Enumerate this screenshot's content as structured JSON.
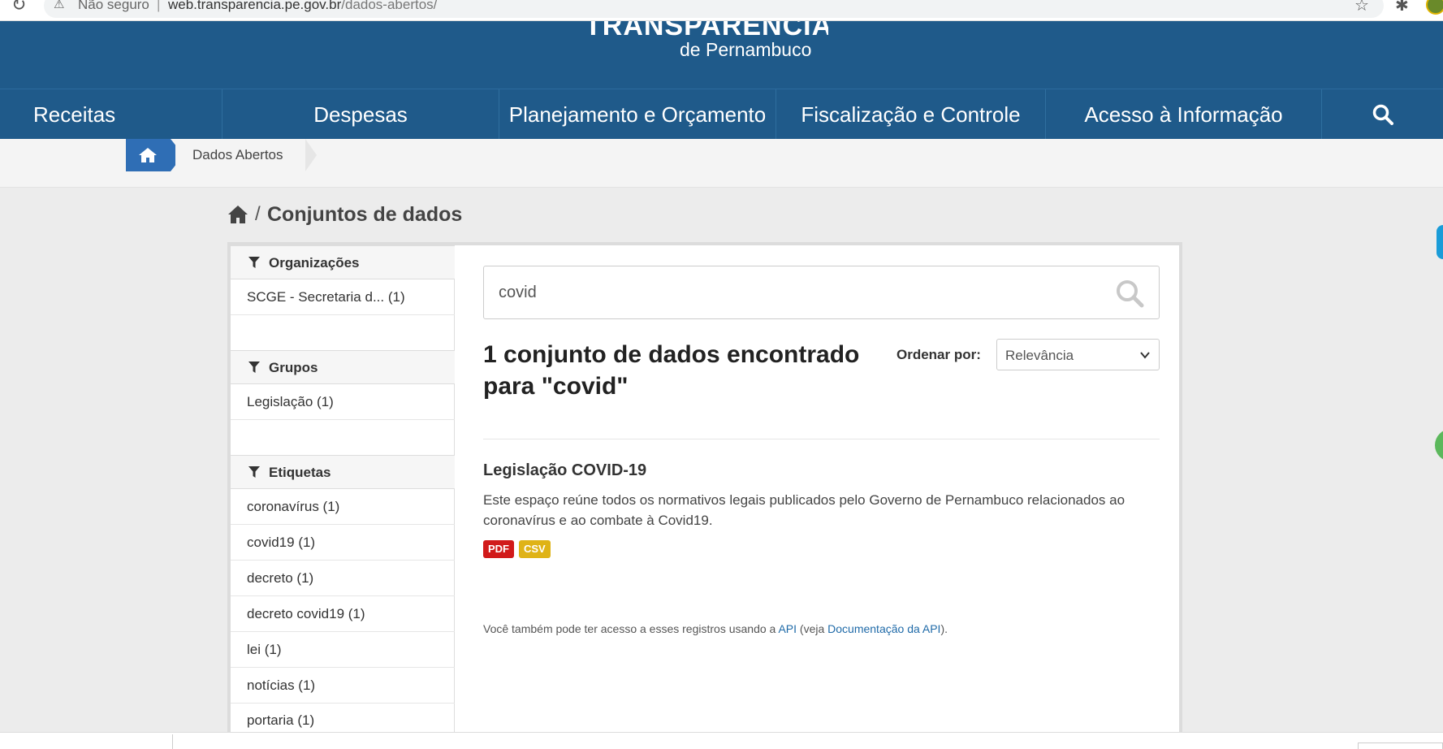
{
  "browser": {
    "security_label": "Não seguro",
    "separator": "|",
    "url_host": "web.transparencia.pe.gov.br",
    "url_path": "/dados-abertos/"
  },
  "header": {
    "logo_title": "TRANSPARÊNCIA",
    "logo_subtitle": "de Pernambuco"
  },
  "nav": {
    "items": [
      {
        "label": "Receitas"
      },
      {
        "label": "Despesas"
      },
      {
        "label": "Planejamento e Orçamento"
      },
      {
        "label": "Fiscalização e Controle"
      },
      {
        "label": "Acesso à Informação"
      }
    ]
  },
  "breadcrumb": {
    "current": "Dados Abertos"
  },
  "page": {
    "slash": "/",
    "title": "Conjuntos de dados"
  },
  "facets": {
    "organizations": {
      "title": "Organizações",
      "items": [
        "SCGE - Secretaria d... (1)"
      ]
    },
    "groups": {
      "title": "Grupos",
      "items": [
        "Legislação (1)"
      ]
    },
    "tags": {
      "title": "Etiquetas",
      "items": [
        "coronavírus (1)",
        "covid19 (1)",
        "decreto (1)",
        "decreto covid19 (1)",
        "lei (1)",
        "notícias (1)",
        "portaria (1)"
      ]
    }
  },
  "search": {
    "value": "covid"
  },
  "results": {
    "count_text": "1 conjunto de dados encontrado para \"covid\"",
    "order_label": "Ordenar por:",
    "order_value": "Relevância",
    "datasets": [
      {
        "title": "Legislação COVID-19",
        "description": "Este espaço reúne todos os normativos legais publicados pelo Governo de Pernambuco relacionados ao coronavírus e ao combate à Covid19.",
        "formats": [
          "PDF",
          "CSV"
        ]
      }
    ],
    "api_note_prefix": "Você também pode ter acesso a esses registros usando a ",
    "api_link": "API",
    "api_note_middle": " (veja ",
    "api_docs_link": "Documentação da API",
    "api_note_suffix": ")."
  },
  "colors": {
    "brand": "#1f5a8a",
    "breadcrumb_home": "#2f6eb5",
    "pdf": "#d11a1a",
    "csv": "#dfb317",
    "link": "#1f6aa8"
  }
}
